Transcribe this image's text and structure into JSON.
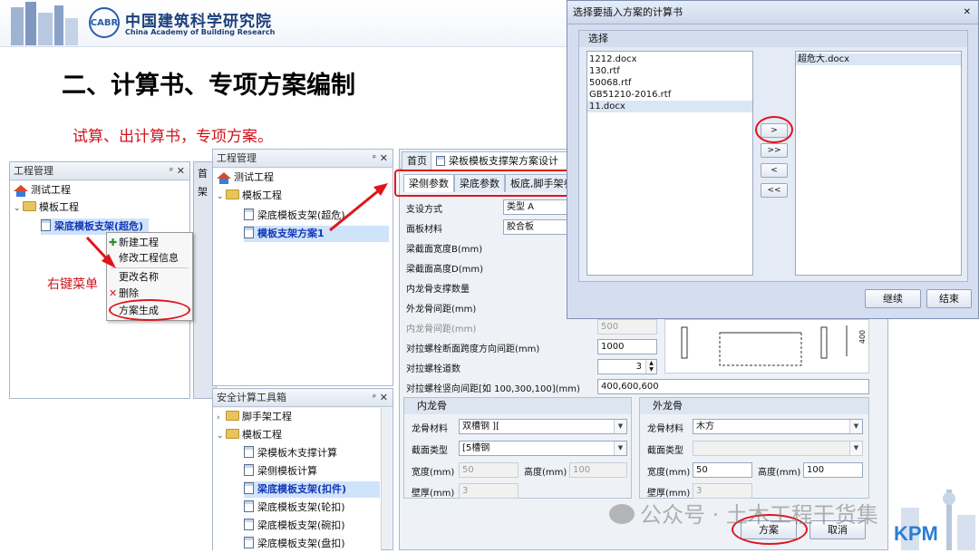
{
  "header": {
    "org_name_cn": "中国建筑科学研究院",
    "org_name_en": "China Academy of Building Research",
    "logo_text": "CABR"
  },
  "slide": {
    "title": "二、计算书、专项方案编制",
    "subtitle": "试算、出计算书，专项方案。",
    "annotation_right_click": "右键菜单"
  },
  "project_panel": {
    "title": "工程管理",
    "pin_glyph": "ᵖ",
    "close_glyph": "✕",
    "tree": [
      {
        "label": "测试工程",
        "icon": "house-icon"
      },
      {
        "label": "模板工程",
        "icon": "folder-icon"
      },
      {
        "label": "梁底模板支架(超危)",
        "icon": "doc-icon"
      }
    ],
    "behind_tab_partial": "首",
    "behind_tab_partial_2": "架"
  },
  "context_menu": {
    "items": [
      "新建工程",
      "修改工程信息",
      "更改名称",
      "删除",
      "方案生成"
    ]
  },
  "project_panel_2": {
    "title": "工程管理",
    "tree": [
      {
        "label": "测试工程",
        "icon": "house-icon"
      },
      {
        "label": "模板工程",
        "icon": "folder-icon"
      },
      {
        "label": "梁底模板支架(超危)",
        "icon": "doc-icon"
      },
      {
        "label": "模板支架方案1",
        "icon": "doc-icon"
      }
    ]
  },
  "toolbox_panel": {
    "title": "安全计算工具箱",
    "tree": [
      {
        "label": "脚手架工程",
        "icon": "folder-icon"
      },
      {
        "label": "模板工程",
        "icon": "folder-icon"
      },
      {
        "label": "梁模板木支撑计算",
        "icon": "doc-icon"
      },
      {
        "label": "梁侧模板计算",
        "icon": "doc-icon"
      },
      {
        "label": "梁底模板支架(扣件)",
        "icon": "doc-icon"
      },
      {
        "label": "梁底模板支架(轮扣)",
        "icon": "doc-icon"
      },
      {
        "label": "梁底模板支架(碗扣)",
        "icon": "doc-icon"
      },
      {
        "label": "梁底模板支架(盘扣)",
        "icon": "doc-icon"
      }
    ]
  },
  "design_window": {
    "tabs": [
      "首页",
      "梁板模板支撑架方案设计"
    ],
    "tab_close": "✕",
    "sub_tabs": [
      "梁侧参数",
      "梁底参数",
      "板底,脚手架参"
    ],
    "fields": [
      {
        "label": "支设方式",
        "value": "类型 A",
        "type": "combo"
      },
      {
        "label": "面板材料",
        "value": "胶合板",
        "type": "combo"
      },
      {
        "label": "梁截面宽度B(mm)",
        "value": ""
      },
      {
        "label": "梁截面高度D(mm)",
        "value": ""
      },
      {
        "label": "内龙骨支撑数量",
        "value": ""
      },
      {
        "label": "外龙骨间距(mm)",
        "value": ""
      },
      {
        "label": "内龙骨间距(mm)",
        "value": "500",
        "disabled": true
      },
      {
        "label": "对拉螺栓断面跨度方向间距(mm)",
        "value": "1000"
      },
      {
        "label": "对拉螺栓道数",
        "value": "3"
      },
      {
        "label": "对拉螺栓竖向间距[如 100,300,100](mm)",
        "value": "400,600,600"
      }
    ],
    "inner_group": {
      "title": "内龙骨",
      "material_label": "龙骨材料",
      "material_value": "双槽钢 ][",
      "section_label": "截面类型",
      "section_value": "[5槽钢",
      "width_label": "宽度(mm)",
      "width_value": "50",
      "height_label": "高度(mm)",
      "height_value": "100",
      "wall_label": "壁厚(mm)",
      "wall_value": "3"
    },
    "outer_group": {
      "title": "外龙骨",
      "material_label": "龙骨材料",
      "material_value": "木方",
      "section_label": "截面类型",
      "section_value": "",
      "width_label": "宽度(mm)",
      "width_value": "50",
      "height_label": "高度(mm)",
      "height_value": "100",
      "wall_label": "壁厚(mm)",
      "wall_value": "3"
    },
    "diagram_label": "400",
    "buttons": {
      "plan": "方案",
      "cancel": "取消"
    }
  },
  "dialog": {
    "title": "选择要插入方案的计算书",
    "close_glyph": "✕",
    "frame_title": "选择",
    "available": [
      "1212.docx",
      "130.rtf",
      "50068.rtf",
      "GB51210-2016.rtf",
      "11.docx"
    ],
    "selected": [
      "超危大.docx"
    ],
    "move_buttons": [
      ">",
      ">>",
      "<",
      "<<"
    ],
    "continue_label": "继续",
    "finish_label": "结束"
  },
  "watermark": {
    "text": "公众号 · 土木工程干货集",
    "brand": "KPM"
  }
}
